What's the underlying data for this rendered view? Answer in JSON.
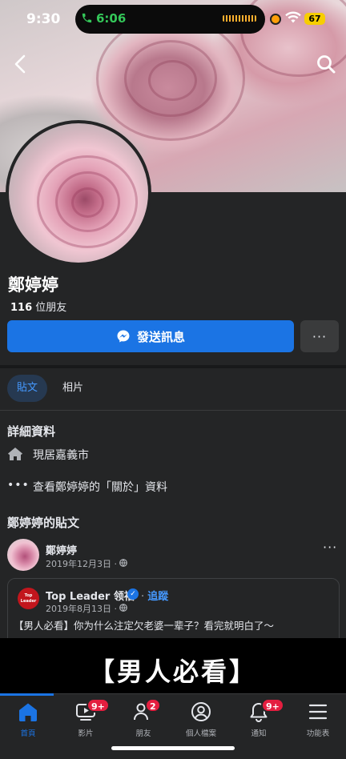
{
  "status_bar": {
    "time": "9:30",
    "call_time": "6:06",
    "battery": "67"
  },
  "profile": {
    "name": "鄭婷婷",
    "friends_count": "116",
    "friends_label": " 位朋友",
    "message_button": "發送訊息",
    "more_button": "···"
  },
  "tabs": [
    {
      "label": "貼文",
      "active": true
    },
    {
      "label": "相片",
      "active": false
    }
  ],
  "details": {
    "title": "詳細資料",
    "location": "現居嘉義市",
    "about_link": "查看鄭婷婷的「關於」資料"
  },
  "posts_section": {
    "title": "鄭婷婷的貼文"
  },
  "post": {
    "author": "鄭婷婷",
    "date": "2019年12月3日 · ",
    "menu": "···",
    "shared": {
      "page_name": "Top Leader 领袖",
      "logo_text": "Top Leader",
      "follow": "追蹤",
      "date": "2019年8月13日 · ",
      "text": "【男人必看】你为什么注定欠老婆一辈子？看完就明白了～"
    },
    "video_title": "【男人必看】"
  },
  "bottom_nav": [
    {
      "label": "首頁",
      "icon": "home-icon",
      "badge": ""
    },
    {
      "label": "影片",
      "icon": "video-icon",
      "badge": "9+"
    },
    {
      "label": "朋友",
      "icon": "friends-icon",
      "badge": "2"
    },
    {
      "label": "個人檔案",
      "icon": "profile-icon",
      "badge": ""
    },
    {
      "label": "通知",
      "icon": "bell-icon",
      "badge": "9+"
    },
    {
      "label": "功能表",
      "icon": "menu-icon",
      "badge": ""
    }
  ],
  "colors": {
    "accent": "#1b74e4",
    "background": "#242526",
    "badge": "#e41e3f"
  }
}
